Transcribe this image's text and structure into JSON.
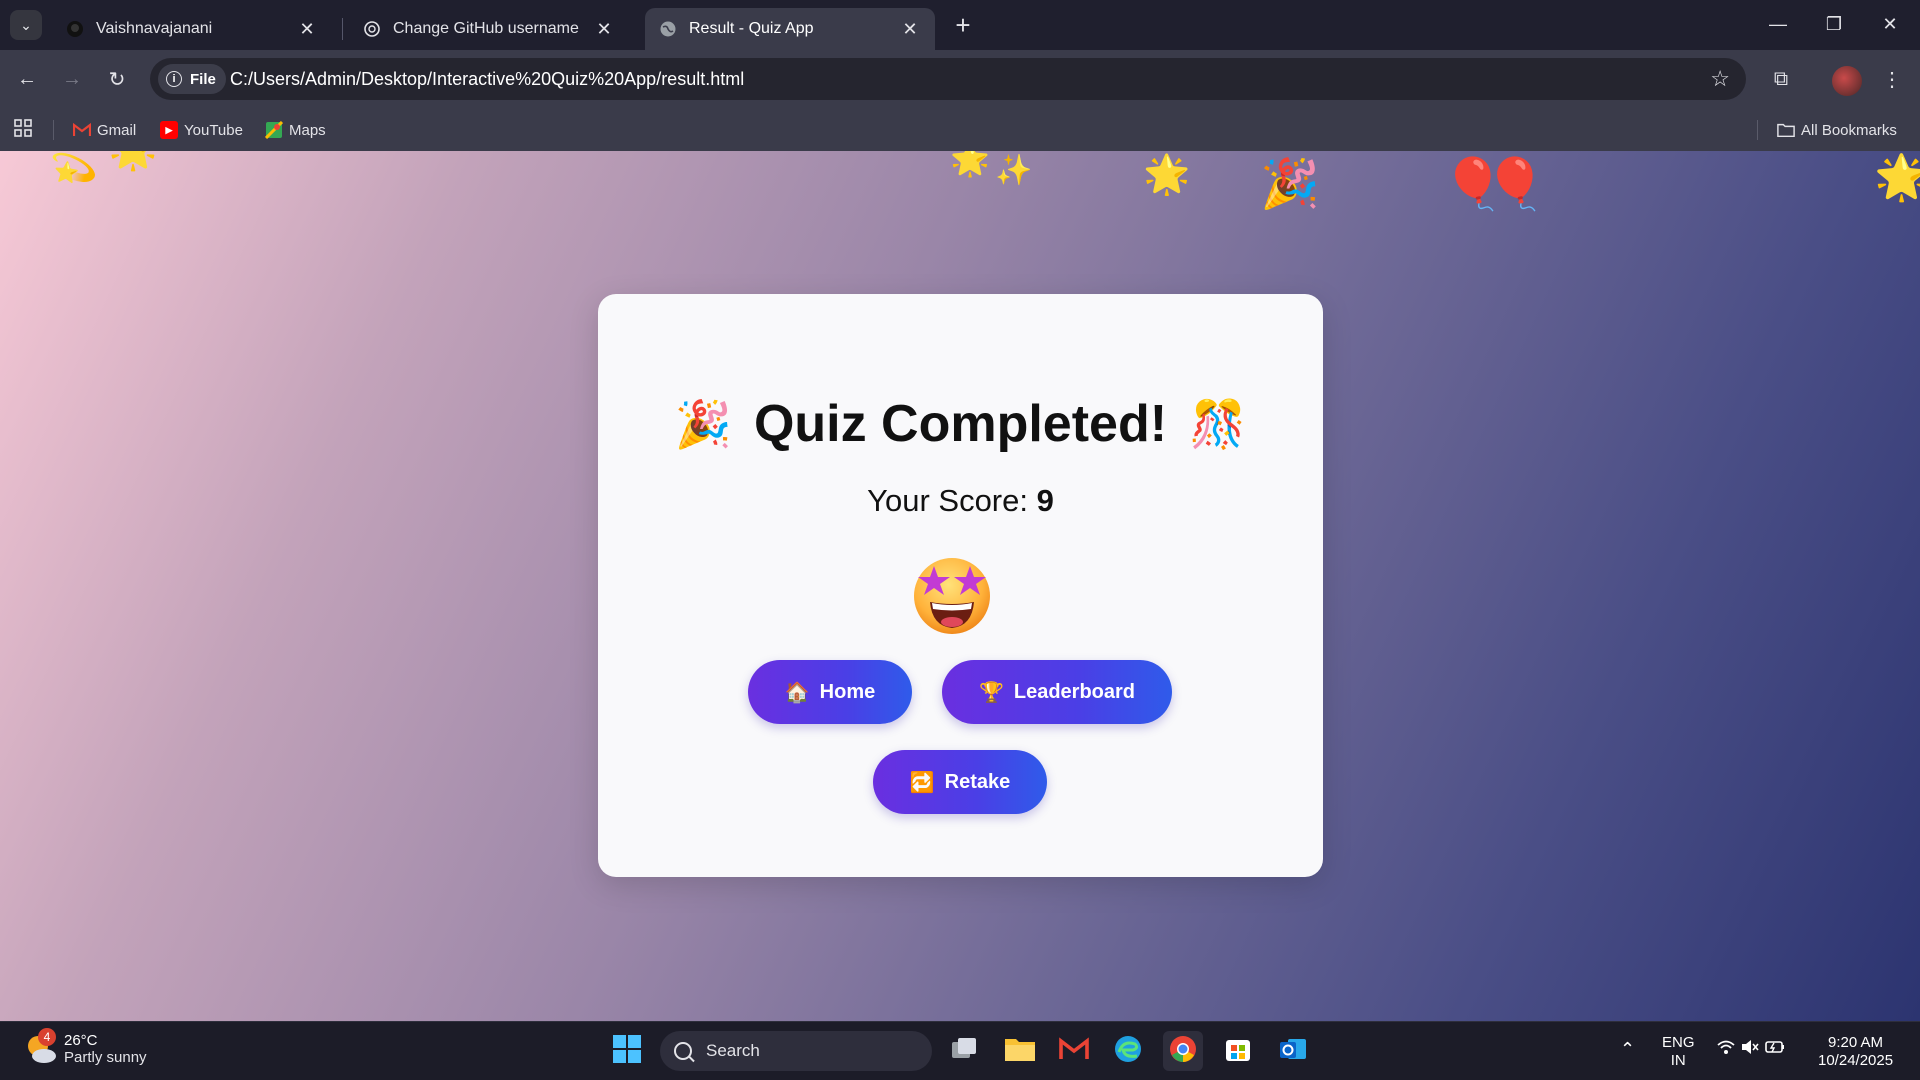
{
  "browser": {
    "tabs": [
      {
        "title": "Vaishnavajanani",
        "favicon": "github-icon",
        "active": false
      },
      {
        "title": "Change GitHub username",
        "favicon": "openai-icon",
        "active": false
      },
      {
        "title": "Result - Quiz App",
        "favicon": "globe-icon",
        "active": true
      }
    ],
    "new_tab_label": "+",
    "chip_label": "File",
    "url": "C:/Users/Admin/Desktop/Interactive%20Quiz%20App/result.html",
    "bookmarks": [
      {
        "label": "Gmail",
        "icon": "gmail-icon"
      },
      {
        "label": "YouTube",
        "icon": "youtube-icon"
      },
      {
        "label": "Maps",
        "icon": "maps-icon"
      }
    ],
    "all_bookmarks_label": "All Bookmarks"
  },
  "quiz": {
    "title": "Quiz Completed!",
    "title_emoji_left": "🎉",
    "title_emoji_right": "🎊",
    "score_label": "Your Score:",
    "score_value": "9",
    "reaction_icon": "star-struck-face-icon",
    "buttons": {
      "home": {
        "label": "Home",
        "icon": "🏠"
      },
      "leaderboard": {
        "label": "Leaderboard",
        "icon": "🏆"
      },
      "retake": {
        "label": "Retake",
        "icon": "🔁"
      }
    },
    "confetti": [
      "💫",
      "🌟",
      "✨",
      "🌟",
      "🎉",
      "🎈",
      "🎈",
      "🌟"
    ]
  },
  "taskbar": {
    "weather_temp": "26°C",
    "weather_desc": "Partly sunny",
    "weather_badge": "4",
    "search_placeholder": "Search",
    "language_line1": "ENG",
    "language_line2": "IN",
    "time": "9:20 AM",
    "date": "10/24/2025"
  },
  "colors": {
    "button_gradient_start": "#6a2fe0",
    "button_gradient_end": "#2f5bea",
    "card_bg": "#f9f9fb",
    "page_gradient_start": "#f7c9d6",
    "page_gradient_end": "#2c3470"
  }
}
